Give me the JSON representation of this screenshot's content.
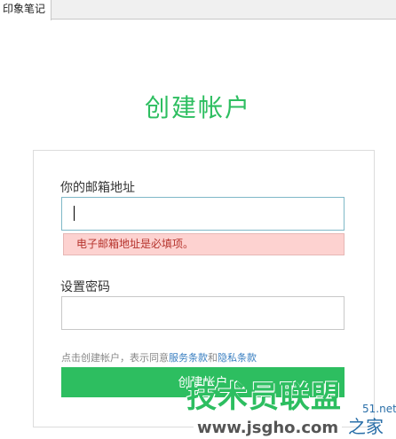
{
  "tab": {
    "label": "印象笔记"
  },
  "page": {
    "title": "创建帐户"
  },
  "form": {
    "email_label": "你的邮箱地址",
    "email_value": "",
    "email_error": "电子邮箱地址是必填项。",
    "password_label": "设置密码",
    "password_value": "",
    "terms_prefix": "点击创建帐户，表示同意",
    "terms_service_link": "服务条款",
    "terms_and": "和",
    "terms_privacy_link": "隐私条款",
    "create_button_label": "创建帐户"
  },
  "watermark": {
    "main": "技术员联盟",
    "suffix": "51.net",
    "url": "www.jsgho.com",
    "home": "之家"
  },
  "colors": {
    "accent": "#2dbe60",
    "error_bg": "#fdd2d0",
    "error_text": "#b6342d",
    "link": "#3a7fc1"
  }
}
